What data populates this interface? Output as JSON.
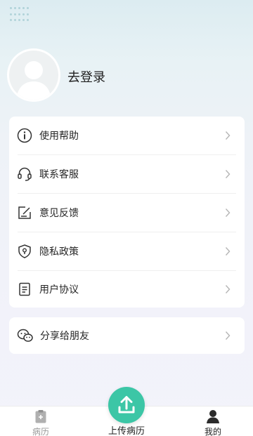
{
  "profile": {
    "login_label": "去登录"
  },
  "menu": {
    "items": [
      {
        "label": "使用帮助",
        "icon": "info-icon"
      },
      {
        "label": "联系客服",
        "icon": "headset-icon"
      },
      {
        "label": "意见反馈",
        "icon": "edit-note-icon"
      },
      {
        "label": "隐私政策",
        "icon": "shield-icon"
      },
      {
        "label": "用户协议",
        "icon": "document-icon"
      }
    ]
  },
  "share": {
    "label": "分享给朋友",
    "icon": "wechat-icon"
  },
  "tabbar": {
    "records_label": "病历",
    "upload_label": "上传病历",
    "mine_label": "我的"
  },
  "colors": {
    "accent": "#3cc6a6",
    "inactive_tab": "#9a9a9a",
    "active_tab": "#222222"
  }
}
